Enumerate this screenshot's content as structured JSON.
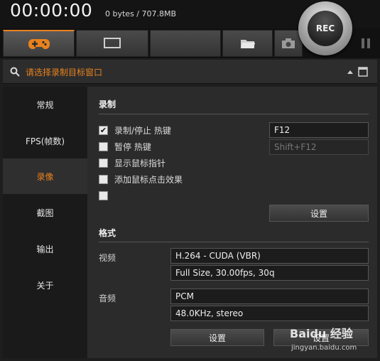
{
  "header": {
    "timer": "00:00:00",
    "file_size": "0 bytes / 707.8MB"
  },
  "toolbar": {
    "tabs": [
      {
        "name": "game-mode",
        "icon": "gamepad-icon"
      },
      {
        "name": "screen-mode",
        "icon": "monitor-icon"
      },
      {
        "name": "device-mode",
        "icon": ""
      },
      {
        "name": "open-folder",
        "icon": "folder-icon"
      },
      {
        "name": "screenshot",
        "icon": "camera-icon"
      }
    ],
    "rec_label": "REC"
  },
  "target": {
    "label": "请选择录制目标窗口"
  },
  "sidebar": {
    "items": [
      {
        "label": "常规",
        "active": false
      },
      {
        "label": "FPS(帧数)",
        "active": false
      },
      {
        "label": "录像",
        "active": true
      },
      {
        "label": "截图",
        "active": false
      },
      {
        "label": "输出",
        "active": false
      },
      {
        "label": "关于",
        "active": false
      }
    ]
  },
  "record": {
    "title": "录制",
    "options": [
      {
        "label": "录制/停止 热键",
        "checked": true
      },
      {
        "label": "暂停 热键",
        "checked": false
      },
      {
        "label": "显示鼠标指针",
        "checked": false
      },
      {
        "label": "添加鼠标点击效果",
        "checked": false
      },
      {
        "label": "",
        "checked": false
      }
    ],
    "hotkey_record": "F12",
    "hotkey_pause": "Shift+F12",
    "settings_label": "设置"
  },
  "format": {
    "title": "格式",
    "video_label": "视频",
    "video_codec": "H.264 - CUDA (VBR)",
    "video_detail": "Full Size, 30.00fps, 30q",
    "audio_label": "音频",
    "audio_codec": "PCM",
    "audio_detail": "48.0KHz, stereo",
    "settings_label": "设置",
    "settings2_label": "设置"
  },
  "watermark": {
    "text": "Baidu 经验",
    "sub": "jingyan.baidu.com"
  },
  "colors": {
    "accent": "#e8821e",
    "background": "#1e1e1e",
    "panel": "#2b2b2b"
  }
}
